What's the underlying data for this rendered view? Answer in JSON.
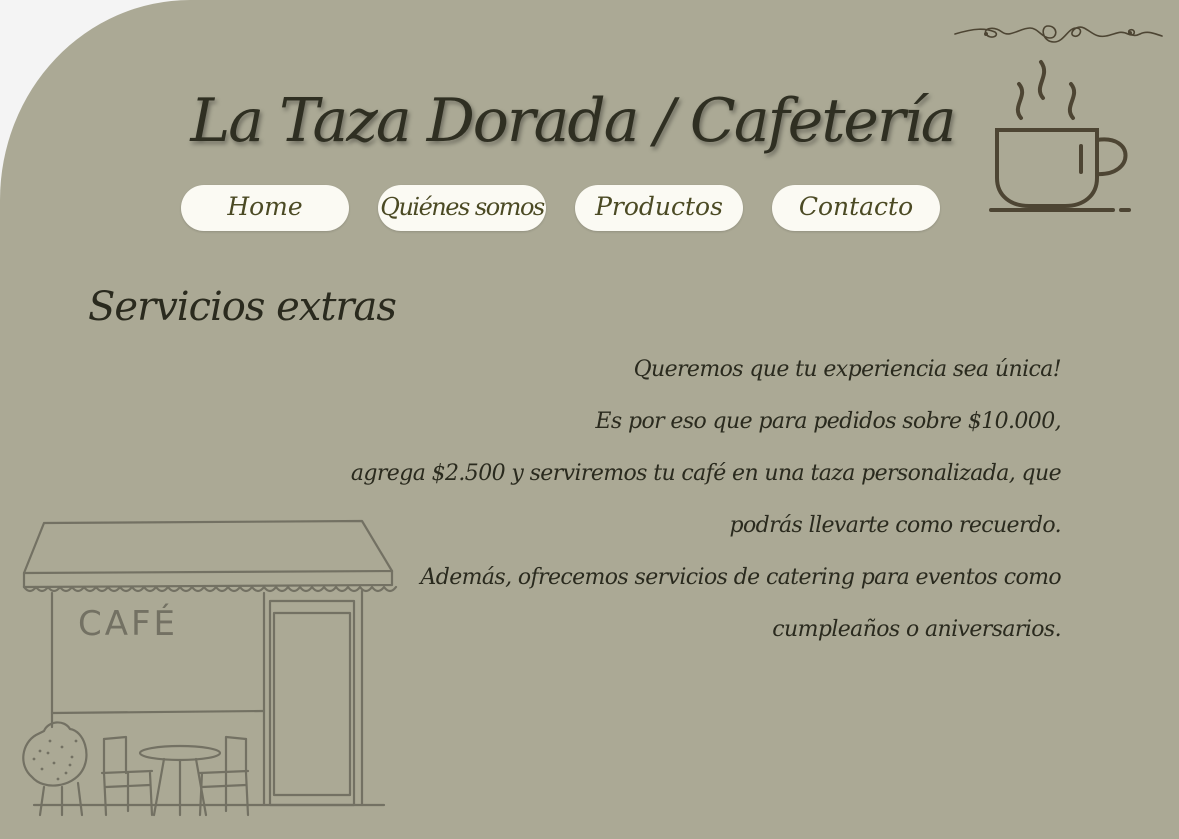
{
  "site": {
    "title": "La Taza Dorada / Cafetería"
  },
  "nav": {
    "items": [
      {
        "label": "Home"
      },
      {
        "label": "Quiénes somos"
      },
      {
        "label": "Productos"
      },
      {
        "label": "Contacto"
      }
    ]
  },
  "section": {
    "title": "Servicios extras",
    "lines": [
      "Queremos que tu experiencia sea única!",
      "Es por eso que para pedidos sobre $10.000,",
      "agrega $2.500 y serviremos tu café en una taza personalizada, que",
      "podrás llevarte como recuerdo.",
      "Además, ofrecemos servicios de catering para eventos como",
      "cumpleaños o aniversarios."
    ]
  },
  "illustration": {
    "storefront_sign": "CAFÉ",
    "icons": [
      "flourish-ornament-icon",
      "steaming-coffee-cup-icon",
      "cafe-storefront-illustration"
    ]
  },
  "colors": {
    "background": "#aba995",
    "outer_background": "#f4f4f4",
    "button_bg": "#fbfaf3",
    "button_text": "#4b4a24",
    "heading_text": "#2f2f22",
    "line_art": "#4d4533"
  }
}
